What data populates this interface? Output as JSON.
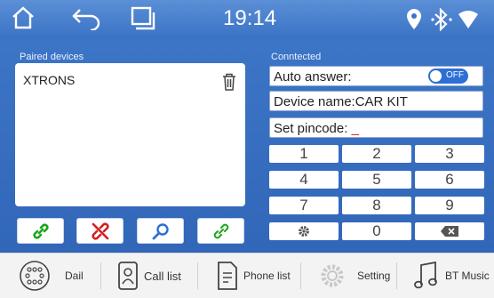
{
  "status_bar": {
    "time": "19:14",
    "icons": [
      "home-icon",
      "back-icon",
      "recent-apps-icon",
      "location-icon",
      "bluetooth-icon",
      "wifi-icon"
    ]
  },
  "paired": {
    "title": "Paired devices",
    "devices": [
      "XTRONS"
    ],
    "actions": [
      "connect-icon",
      "disconnect-icon",
      "search-icon",
      "pair-icon"
    ]
  },
  "connected": {
    "title": "Conntected",
    "auto_answer_label": "Auto answer:",
    "auto_answer_state": "OFF",
    "device_name": "Device name:CAR KIT",
    "pincode_label": "Set pincode:",
    "pincode_cursor": "_"
  },
  "keypad": {
    "keys": [
      "1",
      "2",
      "3",
      "4",
      "5",
      "6",
      "7",
      "8",
      "9",
      "",
      "0",
      ""
    ]
  },
  "bottom_nav": [
    {
      "label": "Dail",
      "icon": "dialpad-icon"
    },
    {
      "label": "Call list",
      "icon": "call-list-icon"
    },
    {
      "label": "Phone list",
      "icon": "phone-list-icon"
    },
    {
      "label": "Setting",
      "icon": "setting-icon"
    },
    {
      "label": "BT Music",
      "icon": "music-icon"
    }
  ],
  "colors": {
    "background": "#3a6fc2",
    "accent": "#2e6fd6",
    "connect_green": "#1aa51a",
    "disconnect_red": "#d42020"
  }
}
